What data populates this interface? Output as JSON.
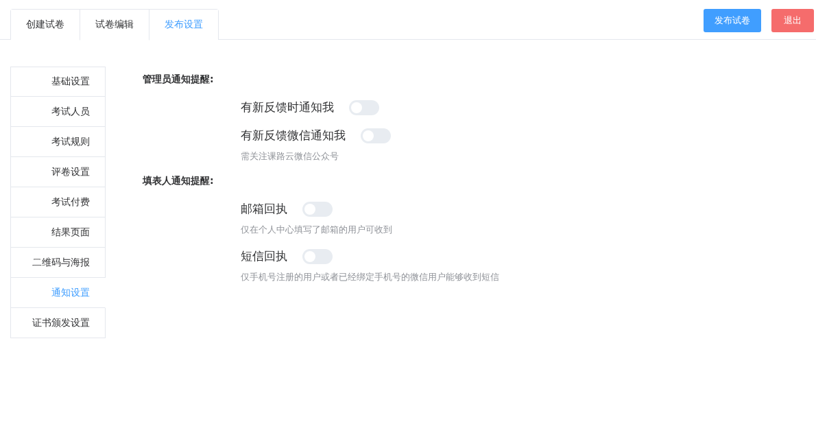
{
  "tabs": [
    {
      "label": "创建试卷",
      "selected": false
    },
    {
      "label": "试卷编辑",
      "selected": false
    },
    {
      "label": "发布设置",
      "selected": true
    }
  ],
  "actions": [
    {
      "label": "发布试卷",
      "kind": "primary"
    },
    {
      "label": "退出",
      "kind": "danger"
    }
  ],
  "sidebar": {
    "items": [
      {
        "label": "基础设置",
        "selected": false
      },
      {
        "label": "考试人员",
        "selected": false
      },
      {
        "label": "考试规则",
        "selected": false
      },
      {
        "label": "评卷设置",
        "selected": false
      },
      {
        "label": "考试付费",
        "selected": false
      },
      {
        "label": "结果页面",
        "selected": false
      },
      {
        "label": "二维码与海报",
        "selected": false
      },
      {
        "label": "通知设置",
        "selected": true
      },
      {
        "label": "证书颁发设置",
        "selected": false
      }
    ]
  },
  "sections": [
    {
      "title": "管理员通知提醒:",
      "items": [
        {
          "label": "有新反馈时通知我",
          "on": false
        },
        {
          "label": "有新反馈微信通知我",
          "on": false,
          "hint": "需关注课路云微信公众号"
        }
      ]
    },
    {
      "title": "填表人通知提醒:",
      "items": [
        {
          "label": "邮箱回执",
          "on": false,
          "hint": "仅在个人中心填写了邮箱的用户可收到"
        },
        {
          "label": "短信回执",
          "on": false,
          "hint": "仅手机号注册的用户或者已经绑定手机号的微信用户能够收到短信"
        }
      ]
    }
  ]
}
